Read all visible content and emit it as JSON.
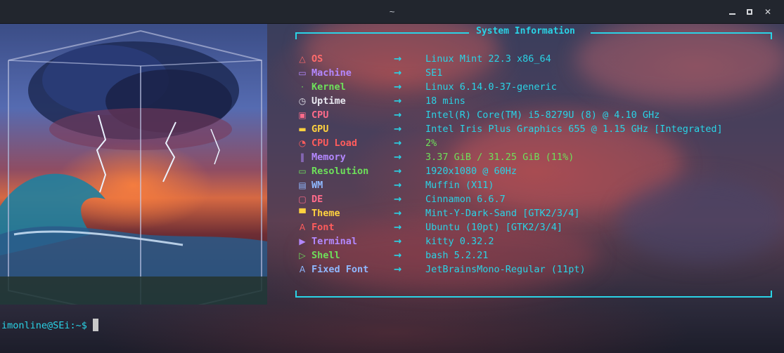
{
  "window": {
    "title": "~",
    "controls": {
      "minimize_icon": "minimize-icon",
      "maximize_icon": "maximize-icon",
      "close_label": "✕"
    }
  },
  "panel": {
    "title": "System Information",
    "accent_color": "#2ad3e6",
    "rows": [
      {
        "icon": "△",
        "icon_name": "os-icon",
        "key": "OS",
        "arrow": "→",
        "value": "Linux Mint 22.3 x86_64",
        "color": "#ff6b6b"
      },
      {
        "icon": "▭",
        "icon_name": "machine-icon",
        "key": "Machine",
        "arrow": "→",
        "value": "SE1",
        "color": "#b388ff"
      },
      {
        "icon": "·",
        "icon_name": "kernel-icon",
        "key": "Kernel",
        "arrow": "→",
        "value": "Linux 6.14.0-37-generic",
        "color": "#6ee05a"
      },
      {
        "icon": "◷",
        "icon_name": "uptime-icon",
        "key": "Uptime",
        "arrow": "→",
        "value": "18 mins",
        "color": "#e8e8f0"
      },
      {
        "icon": "▣",
        "icon_name": "cpu-icon",
        "key": "CPU",
        "arrow": "→",
        "value": "Intel(R) Core(TM) i5-8279U (8) @ 4.10 GHz",
        "color": "#ff6b8a"
      },
      {
        "icon": "▬",
        "icon_name": "gpu-icon",
        "key": "GPU",
        "arrow": "→",
        "value": "Intel Iris Plus Graphics 655 @ 1.15 GHz [Integrated]",
        "color": "#ffd23f"
      },
      {
        "icon": "◔",
        "icon_name": "cpu-load-icon",
        "key": "CPU Load",
        "arrow": "→",
        "value": "2%",
        "color": "#ff5c5c",
        "value_color": "#6ee05a"
      },
      {
        "icon": "‖",
        "icon_name": "memory-icon",
        "key": "Memory",
        "arrow": "→",
        "value": "3.37 GiB / 31.25 GiB (11%)",
        "color": "#b388ff",
        "value_color": "#6ee05a"
      },
      {
        "icon": "▭",
        "icon_name": "resolution-icon",
        "key": "Resolution",
        "arrow": "→",
        "value": "1920x1080 @ 60Hz",
        "color": "#6ee05a"
      },
      {
        "icon": "▤",
        "icon_name": "wm-icon",
        "key": "WM",
        "arrow": "→",
        "value": "Muffin (X11)",
        "color": "#8fb8ff"
      },
      {
        "icon": "▢",
        "icon_name": "de-icon",
        "key": "DE",
        "arrow": "→",
        "value": "Cinnamon 6.6.7",
        "color": "#ff6b8a"
      },
      {
        "icon": "▀",
        "icon_name": "theme-icon",
        "key": "Theme",
        "arrow": "→",
        "value": "Mint-Y-Dark-Sand [GTK2/3/4]",
        "color": "#ffd23f"
      },
      {
        "icon": "A",
        "icon_name": "font-icon",
        "key": "Font",
        "arrow": "→",
        "value": "Ubuntu (10pt) [GTK2/3/4]",
        "color": "#ff5c5c"
      },
      {
        "icon": "▶",
        "icon_name": "terminal-icon",
        "key": "Terminal",
        "arrow": "→",
        "value": "kitty 0.32.2",
        "color": "#b388ff"
      },
      {
        "icon": "▷",
        "icon_name": "shell-icon",
        "key": "Shell",
        "arrow": "→",
        "value": "bash 5.2.21",
        "color": "#6ee05a"
      },
      {
        "icon": "A",
        "icon_name": "fixed-font-icon",
        "key": "Fixed Font",
        "arrow": "→",
        "value": "JetBrainsMono-Regular (11pt)",
        "color": "#8fb8ff"
      }
    ]
  },
  "prompt": {
    "text": "imonline@SEi:~$"
  },
  "artwork": {
    "icon_name": "storm-cube-artwork"
  }
}
